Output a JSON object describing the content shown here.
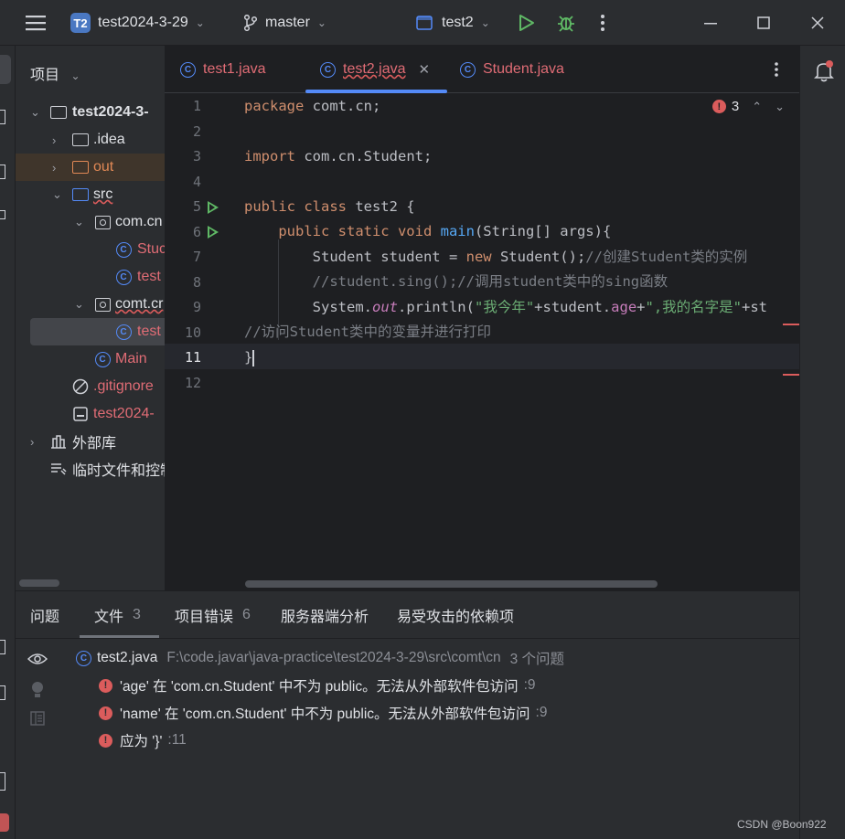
{
  "titlebar": {
    "menu_icon": "hamburger-icon",
    "project_badge": "T2",
    "project_name": "test2024-3-29",
    "branch": "master",
    "run_config": "test2"
  },
  "project_panel": {
    "header": "项目",
    "items": [
      {
        "label": "test2024-3-",
        "kind": "module"
      },
      {
        "label": ".idea",
        "kind": "folder"
      },
      {
        "label": "out",
        "kind": "folder"
      },
      {
        "label": "src",
        "kind": "folder"
      },
      {
        "label": "com.cn",
        "kind": "package"
      },
      {
        "label": "Stuc",
        "kind": "class"
      },
      {
        "label": "test",
        "kind": "class"
      },
      {
        "label": "comt.cr",
        "kind": "package"
      },
      {
        "label": "test",
        "kind": "class"
      },
      {
        "label": "Main",
        "kind": "class"
      },
      {
        "label": ".gitignore",
        "kind": "ignore"
      },
      {
        "label": "test2024-",
        "kind": "file"
      },
      {
        "label": "外部库",
        "kind": "library"
      },
      {
        "label": "临时文件和控制",
        "kind": "scratch"
      }
    ]
  },
  "editor": {
    "tabs": [
      {
        "label": "test1.java"
      },
      {
        "label": "test2.java"
      },
      {
        "label": "Student.java"
      }
    ],
    "error_count": "3",
    "line_numbers": [
      "1",
      "2",
      "3",
      "4",
      "5",
      "6",
      "7",
      "8",
      "9",
      "10",
      "11",
      "12"
    ],
    "lines": {
      "l1a": "package",
      "l1b": " comt.cn;",
      "l3a": "import",
      "l3b": " com.cn.Student;",
      "l5a": "public class",
      "l5b": " test2 {",
      "l6a": "    public static void ",
      "l6b": "main",
      "l6c": "(String[] args){",
      "l7a": "        Student student = ",
      "l7b": "new",
      "l7c": " Student();",
      "l7d": "//创建Student类的实例",
      "l8": "        //student.sing();//调用student类中的sing函数",
      "l9a": "        System.",
      "l9b": "out",
      "l9c": ".println(",
      "l9d": "\"我今年\"",
      "l9e": "+student.",
      "l9f": "age",
      "l9g": "+",
      "l9h": "\",我的名字是\"",
      "l9i": "+st",
      "l10": "//访问Student类中的变量并进行打印",
      "l11": "}"
    }
  },
  "problems": {
    "tabs": [
      {
        "label": "问题",
        "count": ""
      },
      {
        "label": "文件",
        "count": "3"
      },
      {
        "label": "项目错误",
        "count": "6"
      },
      {
        "label": "服务器端分析",
        "count": ""
      },
      {
        "label": "易受攻击的依赖项",
        "count": ""
      }
    ],
    "file": {
      "name": "test2.java",
      "path": "F:\\code.javar\\java-practice\\test2024-3-29\\src\\comt\\cn",
      "summary": "3 个问题"
    },
    "issues": [
      {
        "message": "'age' 在 'com.cn.Student' 中不为 public。无法从外部软件包访问",
        "line": ":9"
      },
      {
        "message": "'name' 在 'com.cn.Student' 中不为 public。无法从外部软件包访问",
        "line": ":9"
      },
      {
        "message": "应为 '}'",
        "line": ":11"
      }
    ]
  },
  "watermark": "CSDN @Boon922",
  "colors": {
    "accent": "#548af7",
    "error": "#db5c5c",
    "run": "#5fb865",
    "debug": "#5fb865"
  }
}
